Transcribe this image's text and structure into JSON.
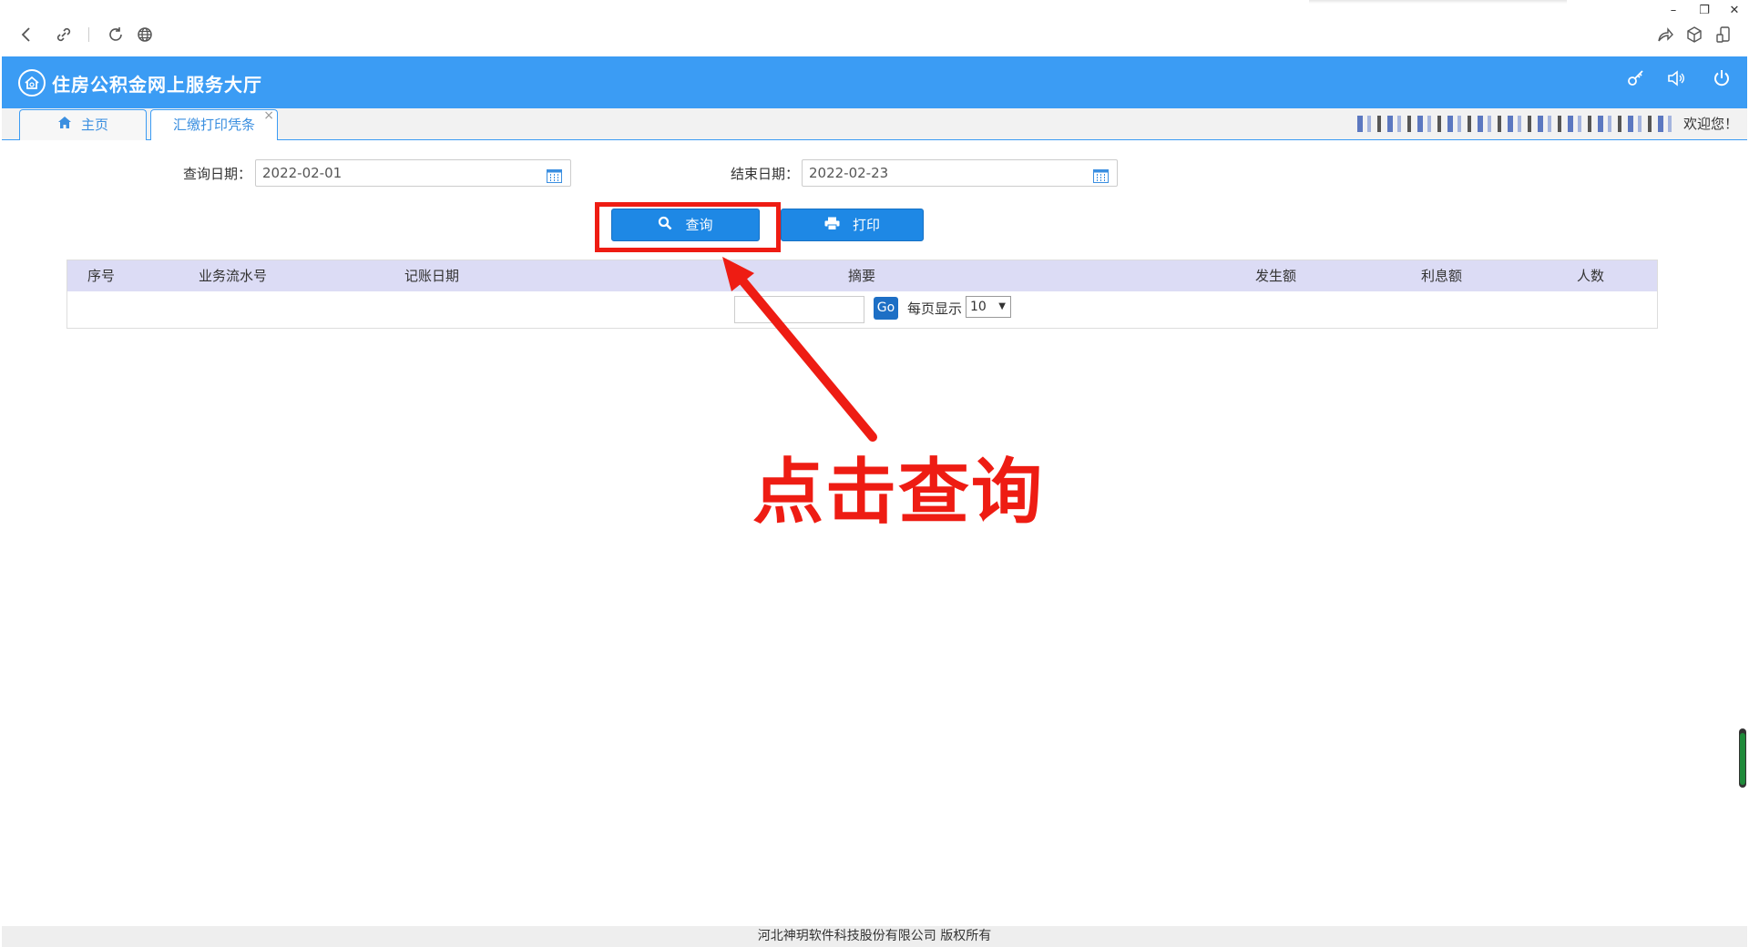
{
  "browser": {
    "back_icon": "chevron-left-icon",
    "link_icon": "link-icon",
    "reload_icon": "reload-icon",
    "globe_icon": "globe-icon",
    "share_icon": "share-icon",
    "box_icon": "cube-icon",
    "mobile_icon": "mobile-icon",
    "minimize": "–",
    "restore": "❐",
    "close": "✕"
  },
  "header": {
    "title": "住房公积金网上服务大厅",
    "bg_color": "#3b9cf4",
    "icons": [
      "key-icon",
      "speaker-icon",
      "power-icon"
    ]
  },
  "tabs": [
    {
      "label": "主页",
      "icon": "home-icon"
    },
    {
      "label": "汇缴打印凭条",
      "close": "×"
    }
  ],
  "user": {
    "welcome": "欢迎您！"
  },
  "form": {
    "start_label": "查询日期：",
    "start_value": "2022-02-01",
    "end_label": "结束日期：",
    "end_value": "2022-02-23"
  },
  "buttons": {
    "query": "查询",
    "print": "打印",
    "color": "#1e88e5"
  },
  "table": {
    "columns": [
      "序号",
      "业务流水号",
      "记账日期",
      "摘要",
      "发生额",
      "利息额",
      "人数"
    ],
    "header_bg": "#dcdcf5"
  },
  "pager": {
    "go_label": "Go",
    "per_page_label": "每页显示",
    "per_page_value": "10"
  },
  "annotation": {
    "text": "点击查询",
    "color": "#ee1c13"
  },
  "footer": {
    "text": "河北神玥软件科技股份有限公司 版权所有"
  }
}
